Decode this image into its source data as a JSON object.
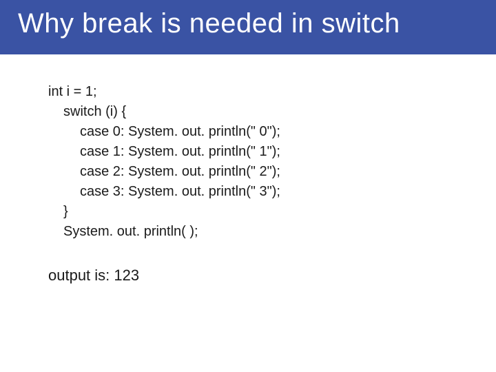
{
  "title": "Why break is needed in switch",
  "code": {
    "line1": "int i = 1;",
    "line2": "switch (i) {",
    "line3": "case 0: System. out. println(\" 0\");",
    "line4": "case 1: System. out. println(\" 1\");",
    "line5": "case 2: System. out. println(\" 2\");",
    "line6": "case 3: System. out. println(\" 3\");",
    "line7": "}",
    "line8": "System. out. println( );"
  },
  "output_label": "output is: 123"
}
